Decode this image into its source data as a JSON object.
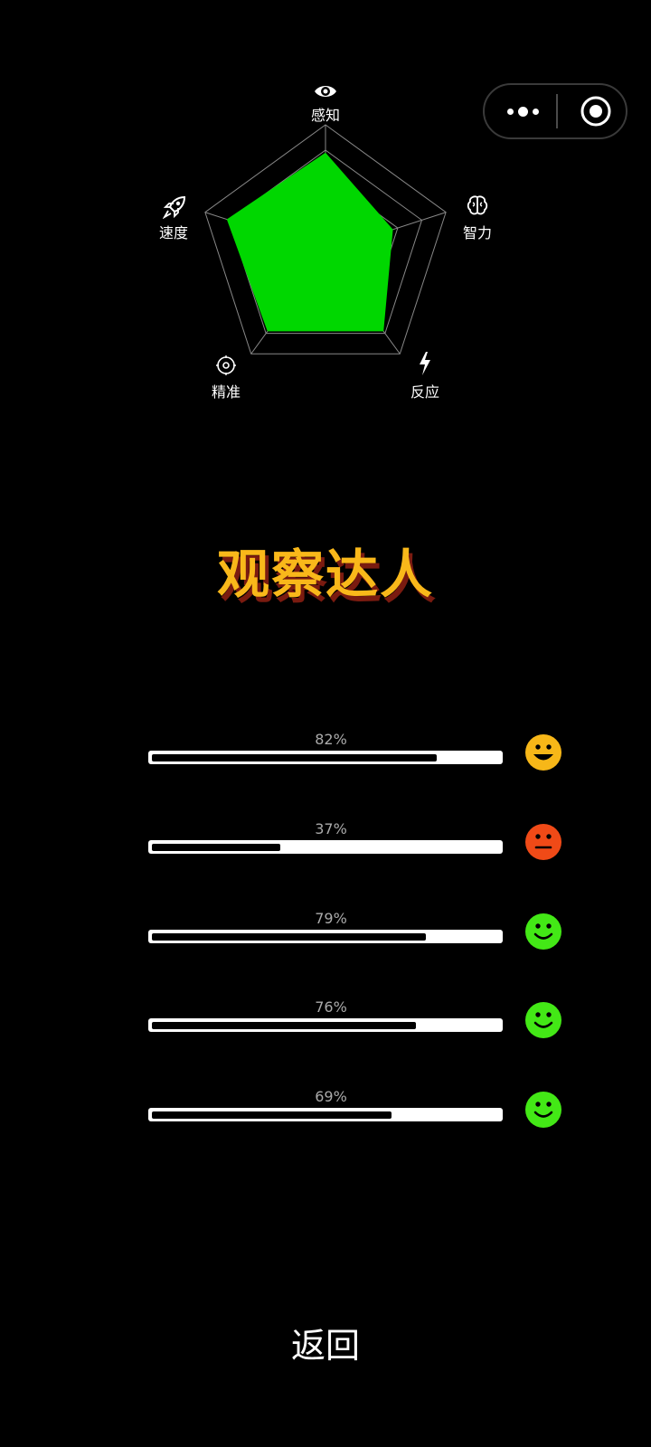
{
  "radar": {
    "axes": [
      {
        "name": "感知",
        "value": 0.78,
        "icon": "eye-icon"
      },
      {
        "name": "智力",
        "value": 0.56,
        "icon": "brain-icon"
      },
      {
        "name": "反应",
        "value": 0.78,
        "icon": "lightning-icon"
      },
      {
        "name": "精准",
        "value": 0.78,
        "icon": "target-icon"
      },
      {
        "name": "速度",
        "value": 0.82,
        "icon": "rocket-icon"
      }
    ],
    "fill_color": "#00d700",
    "grid_color": "#888888",
    "levels": 5
  },
  "title": "观察达人",
  "bars": [
    {
      "percent": "82%",
      "value": 0.82,
      "face": "laughing-face-icon",
      "face_color": "#f7b718"
    },
    {
      "percent": "37%",
      "value": 0.37,
      "face": "neutral-face-icon",
      "face_color": "#f04a17"
    },
    {
      "percent": "79%",
      "value": 0.79,
      "face": "smiling-face-icon",
      "face_color": "#43e816"
    },
    {
      "percent": "76%",
      "value": 0.76,
      "face": "smiling-face-icon",
      "face_color": "#43e816"
    },
    {
      "percent": "69%",
      "value": 0.69,
      "face": "smiling-face-icon",
      "face_color": "#43e816"
    }
  ],
  "back_label": "返回"
}
